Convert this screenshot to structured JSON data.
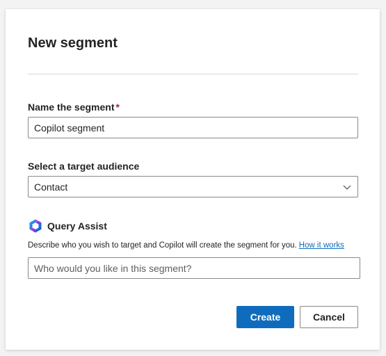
{
  "dialog": {
    "title": "New segment"
  },
  "name_field": {
    "label": "Name the segment",
    "required_mark": "*",
    "value": "Copilot segment"
  },
  "audience_field": {
    "label": "Select a target audience",
    "selected": "Contact",
    "icon": "chevron-down-icon"
  },
  "query_assist": {
    "icon": "copilot-icon",
    "label": "Query Assist",
    "description": "Describe who you wish to target and Copilot will create the segment for you.",
    "link_text": "How it works",
    "placeholder": "Who would you like in this segment?"
  },
  "actions": {
    "create_label": "Create",
    "cancel_label": "Cancel"
  },
  "colors": {
    "primary": "#0f6cbd",
    "required": "#a4262c",
    "text": "#242424"
  }
}
